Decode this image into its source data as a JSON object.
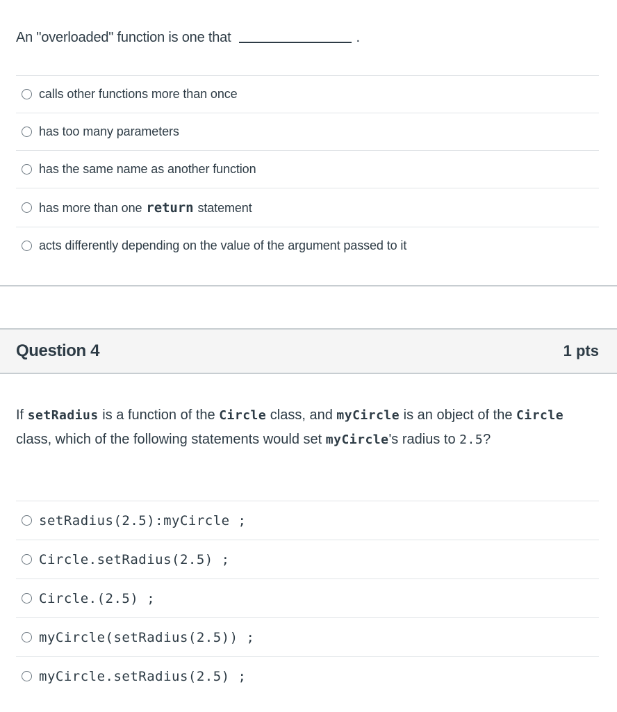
{
  "question3": {
    "prompt": "An \"overloaded\" function is one that",
    "period": ".",
    "answers": [
      {
        "label": "calls other functions more than once"
      },
      {
        "label": "has too many parameters"
      },
      {
        "label": "has the same name as another function"
      },
      {
        "pre": "has more than one",
        "code": "return",
        "post": "statement"
      },
      {
        "label": "acts differently depending on the value of the argument passed to it"
      }
    ]
  },
  "question4": {
    "title": "Question 4",
    "points": "1 pts",
    "prompt_parts": {
      "p1": "If",
      "c1": "setRadius",
      "p2": "is a function of the",
      "c2": "Circle",
      "p3": "class, and",
      "c3": "myCircle",
      "p4": "is an object of the",
      "c4": "Circle",
      "p5": "class, which of the following statements would set",
      "c5": "myCircle",
      "p6": "'s radius to",
      "c6": "2.5",
      "p7": "?"
    },
    "answers": [
      {
        "label": "setRadius(2.5):myCircle ;"
      },
      {
        "label": "Circle.setRadius(2.5) ;"
      },
      {
        "label": "Circle.(2.5) ;"
      },
      {
        "label": "myCircle(setRadius(2.5)) ;"
      },
      {
        "label": "myCircle.setRadius(2.5) ;"
      }
    ]
  }
}
